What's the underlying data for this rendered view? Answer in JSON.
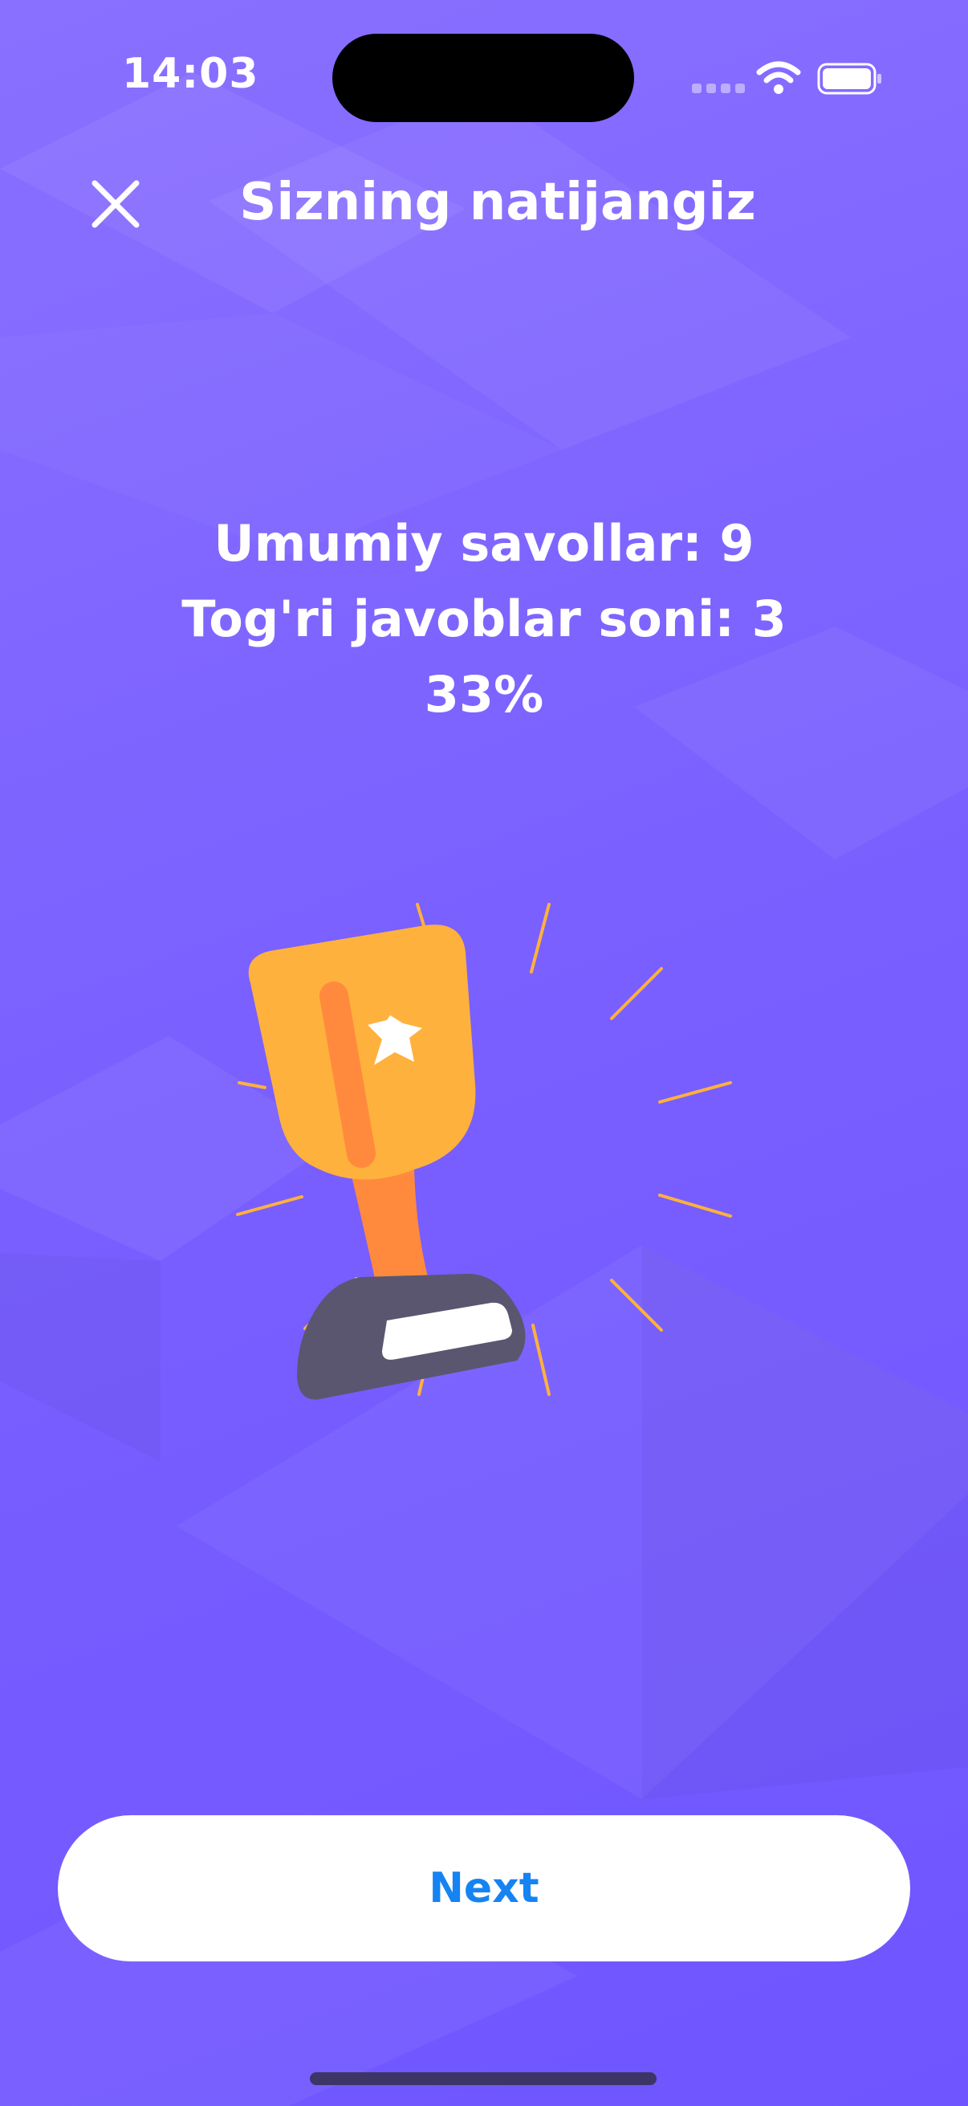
{
  "status_bar": {
    "time": "14:03"
  },
  "header": {
    "close_icon": "close-icon",
    "title": "Sizning natijangiz"
  },
  "results": {
    "total_questions_line": "Umumiy savollar: 9",
    "correct_answers_line": "Tog'ri javoblar soni: 3",
    "percent_line": "33%"
  },
  "illustration": {
    "icon": "trophy-illustration"
  },
  "actions": {
    "next_label": "Next"
  },
  "colors": {
    "background": "#7a60ff",
    "trophy_cup": "#ffb13d",
    "trophy_stem": "#ff8a3d",
    "trophy_base": "#5a5670",
    "button_text": "#1683f2"
  }
}
